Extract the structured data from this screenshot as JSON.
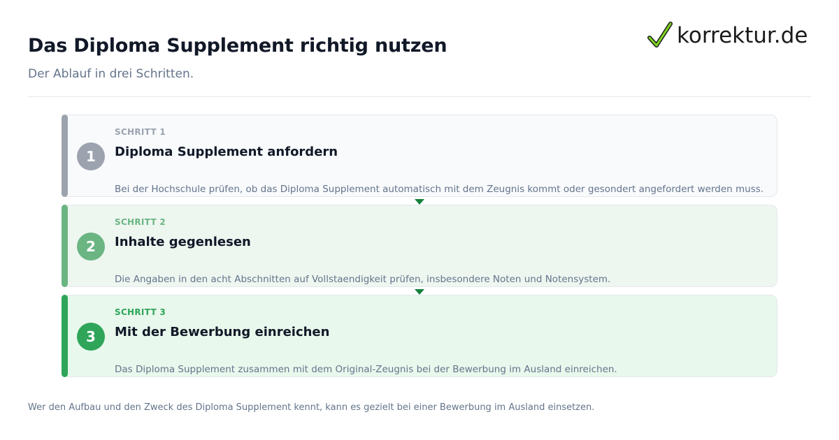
{
  "header": {
    "title": "Das Diploma Supplement richtig nutzen",
    "subtitle": "Der Ablauf in drei Schritten."
  },
  "logo": {
    "text": "korrektur.de",
    "icon": "checkmark-icon",
    "color": "#1a1a1a",
    "check_color": "#7ed321"
  },
  "steps": [
    {
      "number": "1",
      "label": "SCHRITT 1",
      "title": "Diploma Supplement anfordern",
      "description": "Bei der Hochschule prüfen, ob das Diploma Supplement automatisch mit dem Zeugnis kommt oder gesondert angefordert werden muss.",
      "accent": "#9ca3af",
      "background": "#f8fafc"
    },
    {
      "number": "2",
      "label": "SCHRITT 2",
      "title": "Inhalte gegenlesen",
      "description": "Die Angaben in den acht Abschnitten auf Vollstaendigkeit prüfen, insbesondere Noten und Notensystem.",
      "accent": "#6bb583",
      "background": "#eef6f0"
    },
    {
      "number": "3",
      "label": "SCHRITT 3",
      "title": "Mit der Bewerbung einreichen",
      "description": "Das Diploma Supplement zusammen mit dem Original-Zeugnis bei der Bewerbung im Ausland einreichen.",
      "accent": "#2fa55a",
      "background": "#e8f8ec"
    }
  ],
  "footer": {
    "text": "Wer den Aufbau und den Zweck des Diploma Supplement kennt, kann es gezielt bei einer Bewerbung im Ausland einsetzen."
  }
}
